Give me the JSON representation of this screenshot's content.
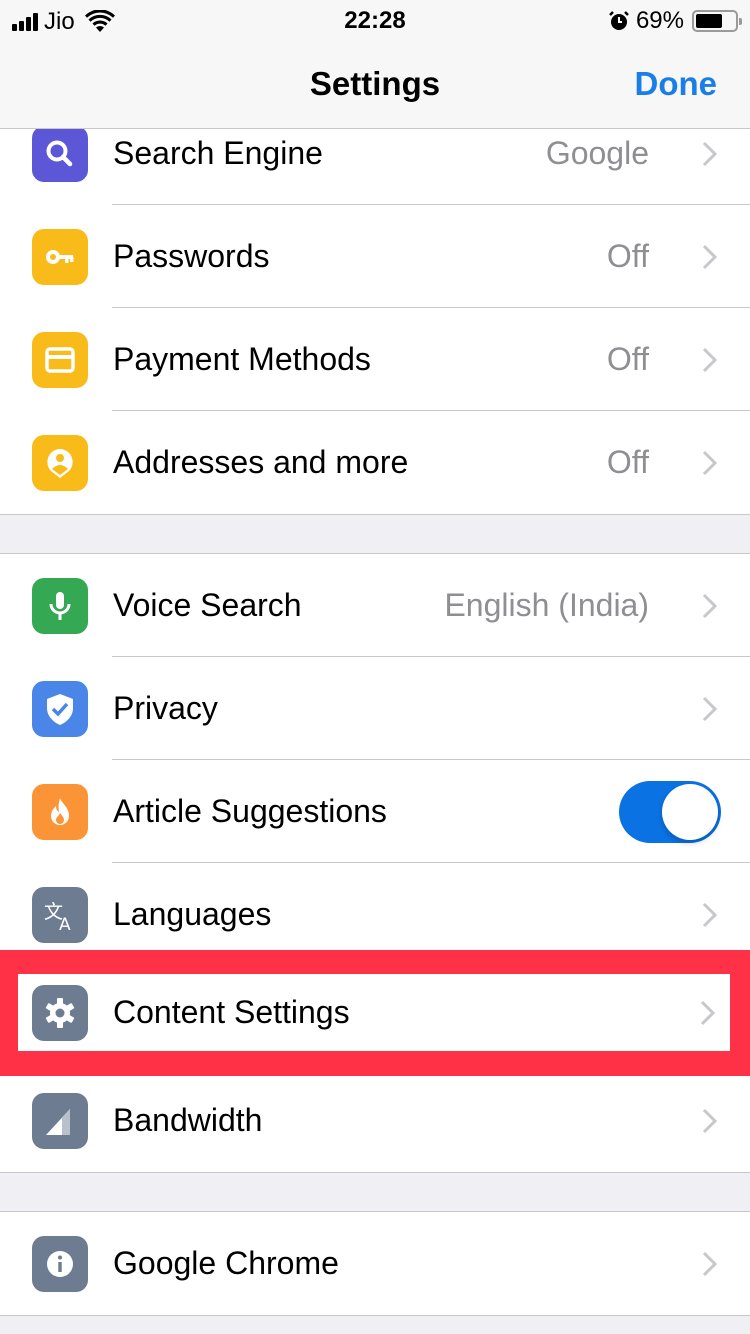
{
  "status_bar": {
    "carrier": "Jio",
    "time": "22:28",
    "battery_percent_label": "69%",
    "battery_level": 0.69,
    "icons": [
      "signal-icon",
      "wifi-icon",
      "alarm-icon",
      "battery-icon"
    ]
  },
  "nav": {
    "title": "Settings",
    "done_label": "Done"
  },
  "colors": {
    "accent": "#1a7ee6",
    "toggle_on": "#0a72e2",
    "highlight": "#fe3146",
    "group_background": "#efeff4",
    "separator": "#c8c7cc",
    "secondary_text": "#8e8e93"
  },
  "sections": [
    {
      "rows": [
        {
          "id": "search-engine",
          "label": "Search Engine",
          "value": "Google",
          "icon": "search-icon",
          "icon_color": "#5b57d6",
          "accessory": "chevron"
        },
        {
          "id": "passwords",
          "label": "Passwords",
          "value": "Off",
          "icon": "key-icon",
          "icon_color": "#f8bb1a",
          "accessory": "chevron"
        },
        {
          "id": "payment-methods",
          "label": "Payment Methods",
          "value": "Off",
          "icon": "credit-card-icon",
          "icon_color": "#f8bb1a",
          "accessory": "chevron"
        },
        {
          "id": "addresses",
          "label": "Addresses and more",
          "value": "Off",
          "icon": "person-pin-icon",
          "icon_color": "#f8bb1a",
          "accessory": "chevron"
        }
      ]
    },
    {
      "rows": [
        {
          "id": "voice-search",
          "label": "Voice Search",
          "value": "English (India)",
          "icon": "microphone-icon",
          "icon_color": "#34a853",
          "accessory": "chevron"
        },
        {
          "id": "privacy",
          "label": "Privacy",
          "value": "",
          "icon": "shield-check-icon",
          "icon_color": "#4a86e8",
          "accessory": "chevron"
        },
        {
          "id": "article-suggestions",
          "label": "Article Suggestions",
          "value": "",
          "icon": "flame-icon",
          "icon_color": "#fb9437",
          "accessory": "toggle",
          "toggle_on": true
        },
        {
          "id": "languages",
          "label": "Languages",
          "value": "",
          "icon": "translate-icon",
          "icon_color": "#6d7c91",
          "accessory": "chevron"
        },
        {
          "id": "content-settings",
          "label": "Content Settings",
          "value": "",
          "icon": "gear-icon",
          "icon_color": "#6d7c91",
          "accessory": "chevron",
          "highlighted": true
        },
        {
          "id": "bandwidth",
          "label": "Bandwidth",
          "value": "",
          "icon": "signal-triangle-icon",
          "icon_color": "#6d7c91",
          "accessory": "chevron"
        }
      ]
    },
    {
      "rows": [
        {
          "id": "google-chrome",
          "label": "Google Chrome",
          "value": "",
          "icon": "info-icon",
          "icon_color": "#6d7c91",
          "accessory": "chevron"
        }
      ]
    }
  ]
}
